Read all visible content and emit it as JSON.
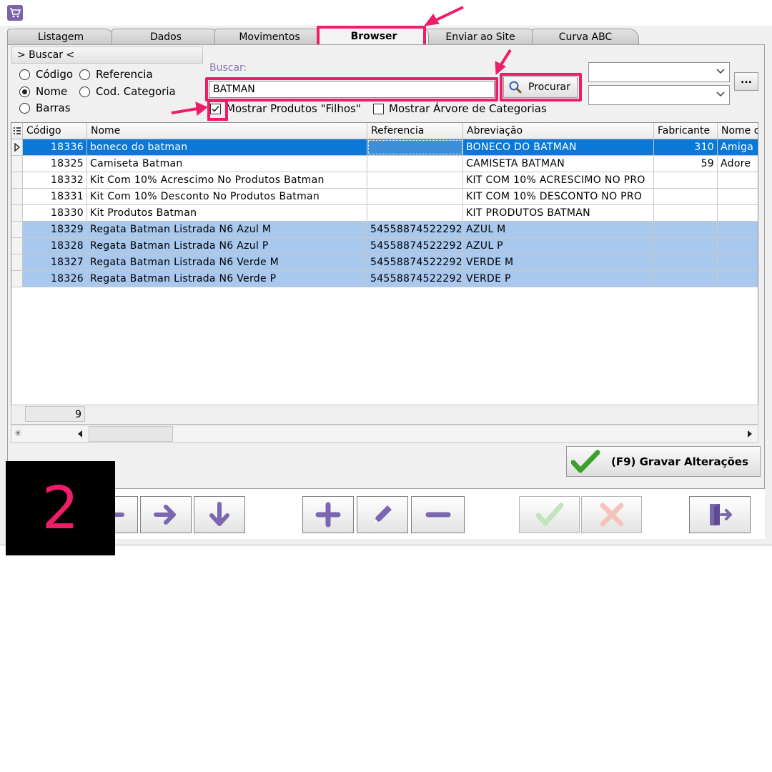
{
  "tabs": [
    "Listagem",
    "Dados",
    "Movimentos",
    "Browser",
    "Enviar ao Site",
    "Curva ABC"
  ],
  "active_tab": "Browser",
  "buscar_toggle": "> Buscar <",
  "search_modes": {
    "codigo": "Código",
    "referencia": "Referencia",
    "nome": "Nome",
    "cod_categoria": "Cod. Categoria",
    "barras": "Barras",
    "selected": "Nome"
  },
  "search": {
    "label": "Buscar:",
    "value": "BATMAN",
    "button": "Procurar",
    "ellipsis": "..."
  },
  "options": {
    "mostrar_filhos": "Mostrar Produtos \"Filhos\"",
    "mostrar_filhos_checked": true,
    "mostrar_arvore": "Mostrar Árvore de Categorias",
    "mostrar_arvore_checked": false
  },
  "grid": {
    "columns": [
      "Código",
      "Nome",
      "Referencia",
      "Abreviação",
      "Fabricante",
      "Nome c"
    ],
    "rows": [
      {
        "codigo": "18336",
        "nome": "boneco do batman",
        "referencia": "",
        "abreviacao": "BONECO DO BATMAN",
        "fabricante": "310",
        "nome2": "Amiga",
        "state": "current"
      },
      {
        "codigo": "18325",
        "nome": "Camiseta Batman",
        "referencia": "",
        "abreviacao": "CAMISETA BATMAN",
        "fabricante": "59",
        "nome2": "Adore",
        "state": "normal"
      },
      {
        "codigo": "18332",
        "nome": "Kit Com 10% Acrescimo No Produtos Batman",
        "referencia": "",
        "abreviacao": "KIT COM 10% ACRESCIMO NO PRO",
        "fabricante": "",
        "nome2": "",
        "state": "normal"
      },
      {
        "codigo": "18331",
        "nome": "Kit Com 10% Desconto No Produtos Batman",
        "referencia": "",
        "abreviacao": "KIT COM 10% DESCONTO NO PRO",
        "fabricante": "",
        "nome2": "",
        "state": "normal"
      },
      {
        "codigo": "18330",
        "nome": "Kit Produtos Batman",
        "referencia": "",
        "abreviacao": "KIT PRODUTOS BATMAN",
        "fabricante": "",
        "nome2": "",
        "state": "normal"
      },
      {
        "codigo": "18329",
        "nome": "Regata Batman Listrada N6 Azul M",
        "referencia": "54558874522292",
        "abreviacao": "AZUL M",
        "fabricante": "",
        "nome2": "",
        "state": "selected"
      },
      {
        "codigo": "18328",
        "nome": "Regata Batman Listrada N6 Azul P",
        "referencia": "54558874522292",
        "abreviacao": "AZUL P",
        "fabricante": "",
        "nome2": "",
        "state": "selected"
      },
      {
        "codigo": "18327",
        "nome": "Regata Batman Listrada N6 Verde M",
        "referencia": "54558874522292",
        "abreviacao": "VERDE M",
        "fabricante": "",
        "nome2": "",
        "state": "selected"
      },
      {
        "codigo": "18326",
        "nome": "Regata Batman Listrada N6 Verde P",
        "referencia": "54558874522292",
        "abreviacao": "VERDE P",
        "fabricante": "",
        "nome2": "",
        "state": "selected"
      }
    ],
    "row_count": "9"
  },
  "gravar_button": "(F9) Gravar Alterações",
  "step_number": "2",
  "colors": {
    "highlight": "#ee1d6a",
    "current_row": "#0b78d7",
    "selected_row": "#a8c8ee",
    "accent_purple": "#7a63a8",
    "check_green": "#3aa22a",
    "cancel_red": "#f09a8e"
  },
  "icons": {
    "app": "shopping-cart-icon",
    "procurar": "magnifier-icon",
    "gravar": "green-check-icon",
    "toolbar": [
      "arrow-left-icon",
      "arrow-right-icon",
      "arrow-down-icon",
      "plus-icon",
      "pencil-icon",
      "minus-icon",
      "confirm-check-icon",
      "cancel-x-icon",
      "exit-door-icon"
    ]
  }
}
